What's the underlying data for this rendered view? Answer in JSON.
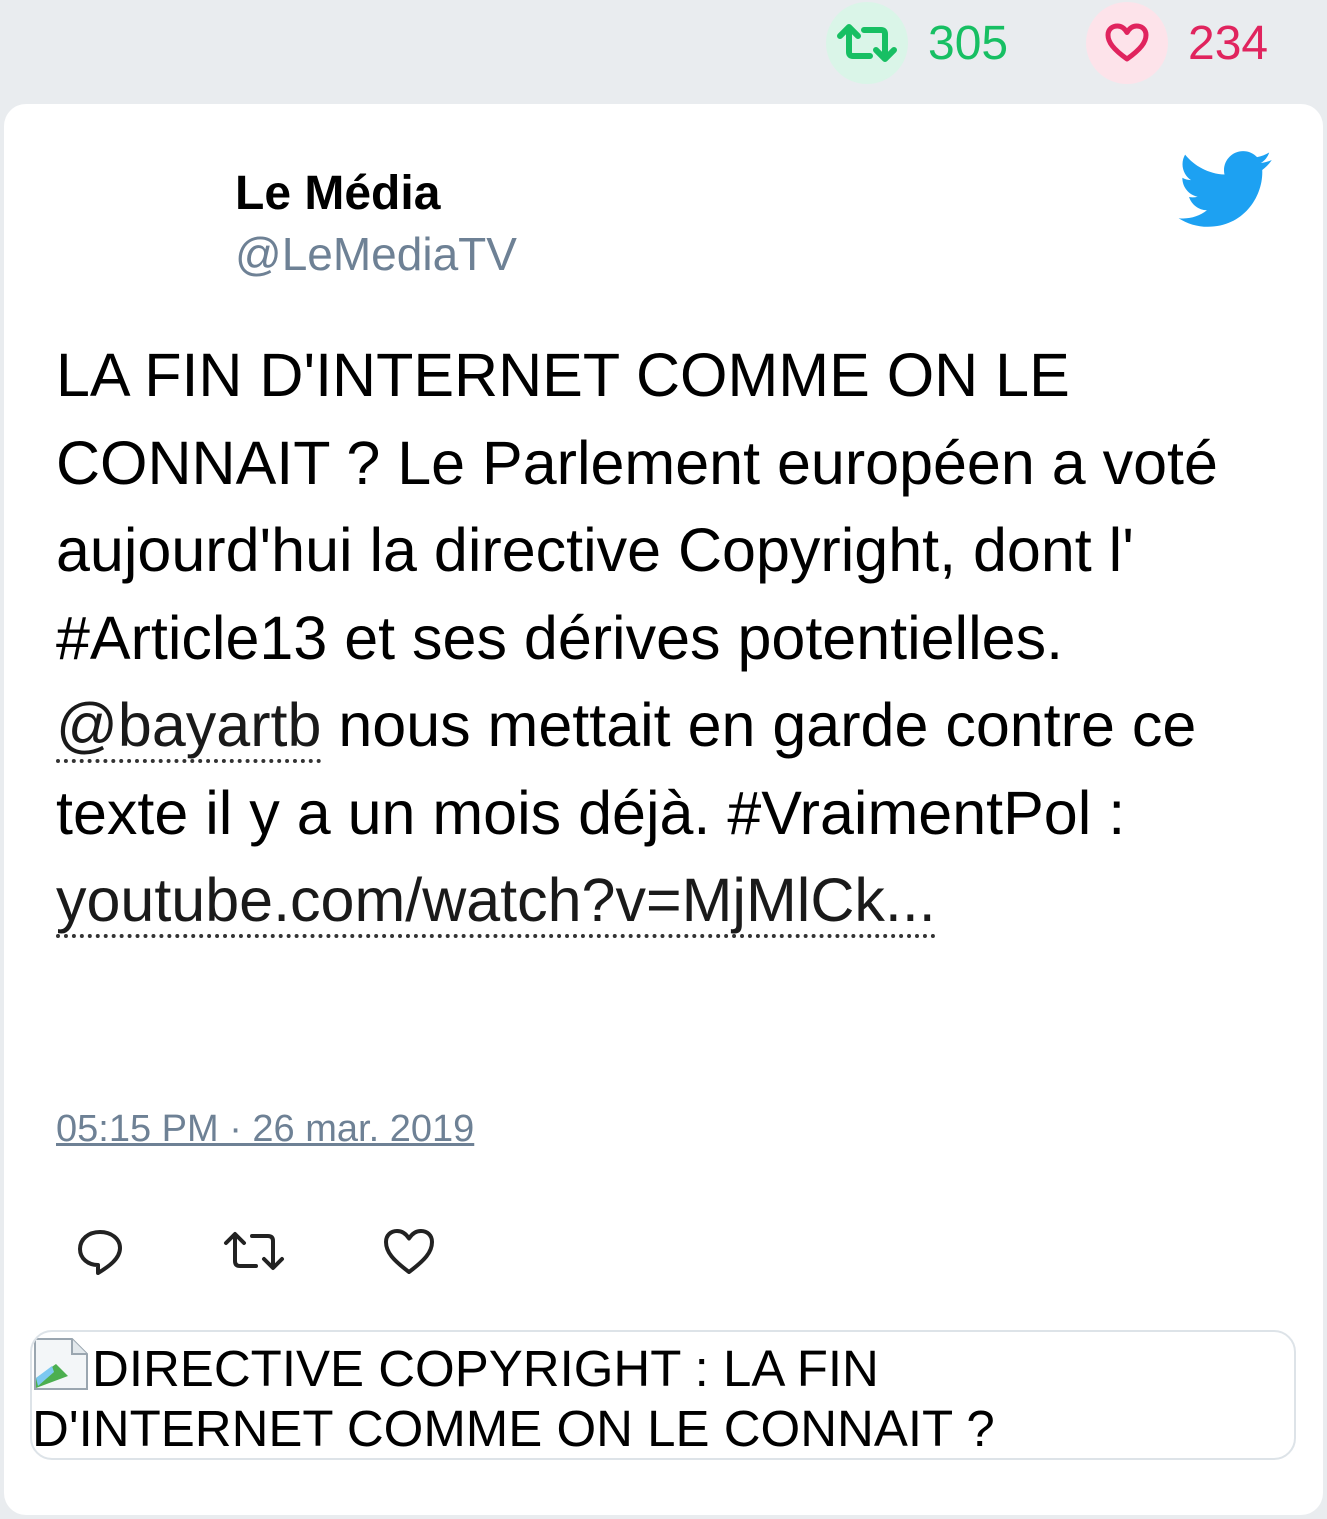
{
  "stats": {
    "retweets": "305",
    "likes": "234"
  },
  "tweet": {
    "author_name": "Le Média",
    "author_handle": "@LeMediaTV",
    "text_part1": "LA FIN D'INTERNET COMME ON LE CONNAIT ? Le Parlement européen a voté aujourd'hui la directive Copyright, dont l' #Article13 et ses dérives potentielles. ",
    "mention": "@bayartb",
    "text_part2": " nous mettait en garde contre ce texte il y a un mois déjà. #VraimentPol : ",
    "link": "youtube.com/watch?v=MjMlCk...",
    "timestamp": "05:15 PM · 26 mar. 2019"
  },
  "preview": {
    "alt_text": "DIRECTIVE COPYRIGHT : LA FIN D'INTERNET COMME ON LE CONNAIT ?"
  },
  "icons": {
    "retweet": "retweet-icon",
    "like": "heart-icon",
    "brand": "twitter-bird-icon",
    "reply": "reply-icon",
    "broken_image": "broken-image-icon"
  },
  "colors": {
    "retweet": "#17bf63",
    "like": "#e0245e",
    "twitter_blue": "#1da1f2",
    "muted": "#6e8195"
  }
}
